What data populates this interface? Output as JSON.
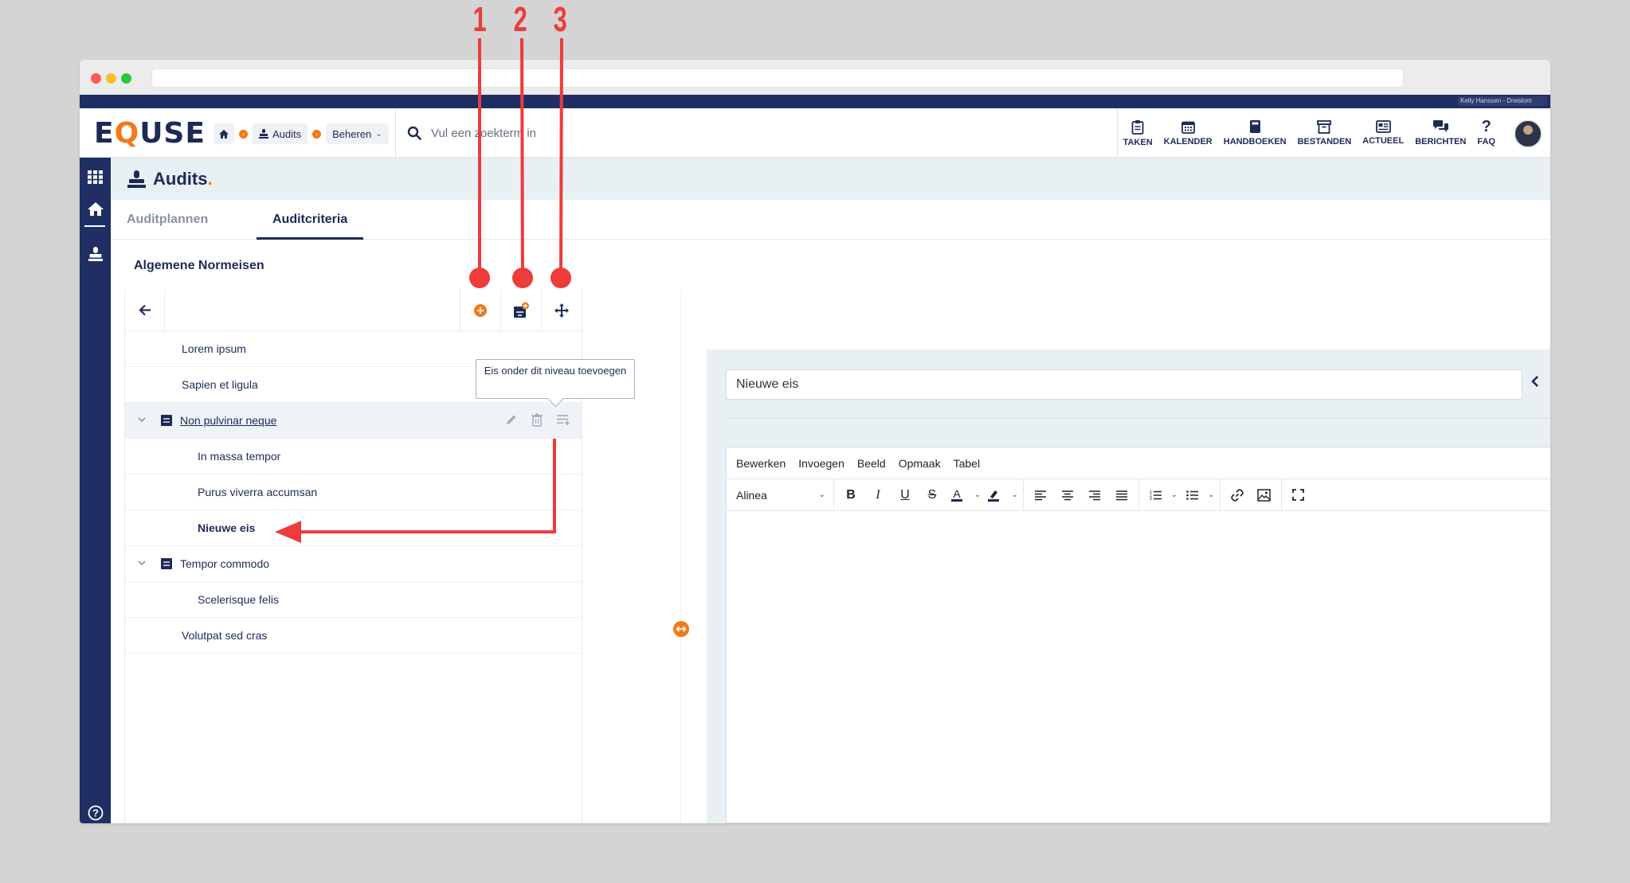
{
  "annotations": {
    "numbers": [
      "1",
      "2",
      "3"
    ],
    "color": "#ee3b3b"
  },
  "app": {
    "logo_prefix": "E",
    "logo_q": "Q",
    "logo_suffix": "USE",
    "user_name": "Kelly Hanssen - Dreislom",
    "brand_color": "#1f2f63",
    "accent_color": "#f07a1a"
  },
  "breadcrumb": {
    "home_icon": "home-icon",
    "audits_label": "Audits",
    "manage_label": "Beheren"
  },
  "search": {
    "placeholder": "Vul een zoekterm in"
  },
  "topnav": [
    {
      "label": "TAKEN",
      "icon": "clipboard-icon"
    },
    {
      "label": "KALENDER",
      "icon": "calendar-icon"
    },
    {
      "label": "HANDBOEKEN",
      "icon": "book-icon"
    },
    {
      "label": "BESTANDEN",
      "icon": "archive-icon"
    },
    {
      "label": "ACTUEEL",
      "icon": "news-icon"
    },
    {
      "label": "BERICHTEN",
      "icon": "chat-icon"
    },
    {
      "label": "FAQ",
      "icon": "question-icon"
    }
  ],
  "page": {
    "title": "Audits",
    "title_dot": "."
  },
  "tabs": {
    "plans": "Auditplannen",
    "criteria": "Auditcriteria"
  },
  "tree": {
    "section_title": "Algemene Normeisen",
    "rows": [
      {
        "label": "Lorem ipsum"
      },
      {
        "label": "Sapien et ligula"
      },
      {
        "label": "Non pulvinar neque"
      },
      {
        "label": "In massa tempor"
      },
      {
        "label": "Purus viverra accumsan"
      },
      {
        "label": "Nieuwe eis"
      },
      {
        "label": "Tempor commodo"
      },
      {
        "label": "Scelerisque felis"
      },
      {
        "label": "Volutpat sed cras"
      }
    ]
  },
  "tooltip": {
    "text": "Eis onder dit niveau toevoegen"
  },
  "editor": {
    "title_value": "Nieuwe eis",
    "menu": [
      "Bewerken",
      "Invoegen",
      "Beeld",
      "Opmaak",
      "Tabel"
    ],
    "block_format": "Alinea"
  }
}
